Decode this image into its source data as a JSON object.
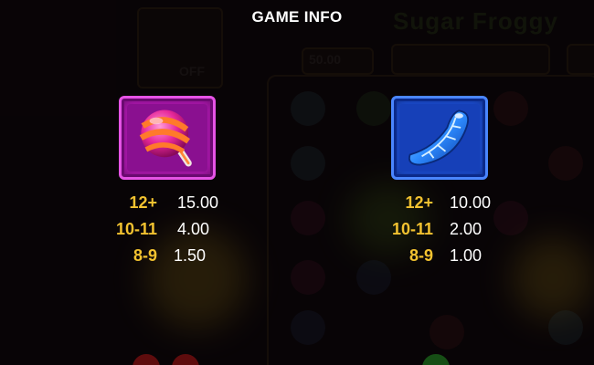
{
  "screen": {
    "title": "GAME INFO"
  },
  "symbols": [
    {
      "name": "lollipop",
      "icon": "lollipop-icon",
      "tile_color": "#b418b6",
      "payouts": [
        {
          "range": "12+",
          "value": "15.00"
        },
        {
          "range": "10-11",
          "value": "4.00"
        },
        {
          "range": "8-9",
          "value": "1.50"
        }
      ]
    },
    {
      "name": "blue-candy",
      "icon": "blue-candy-icon",
      "tile_color": "#1c4fd9",
      "payouts": [
        {
          "range": "12+",
          "value": "10.00"
        },
        {
          "range": "10-11",
          "value": "2.00"
        },
        {
          "range": "8-9",
          "value": "1.00"
        }
      ]
    }
  ],
  "colors": {
    "range_text": "#f2c230",
    "value_text": "#ffffff",
    "background": "#0a0507"
  }
}
